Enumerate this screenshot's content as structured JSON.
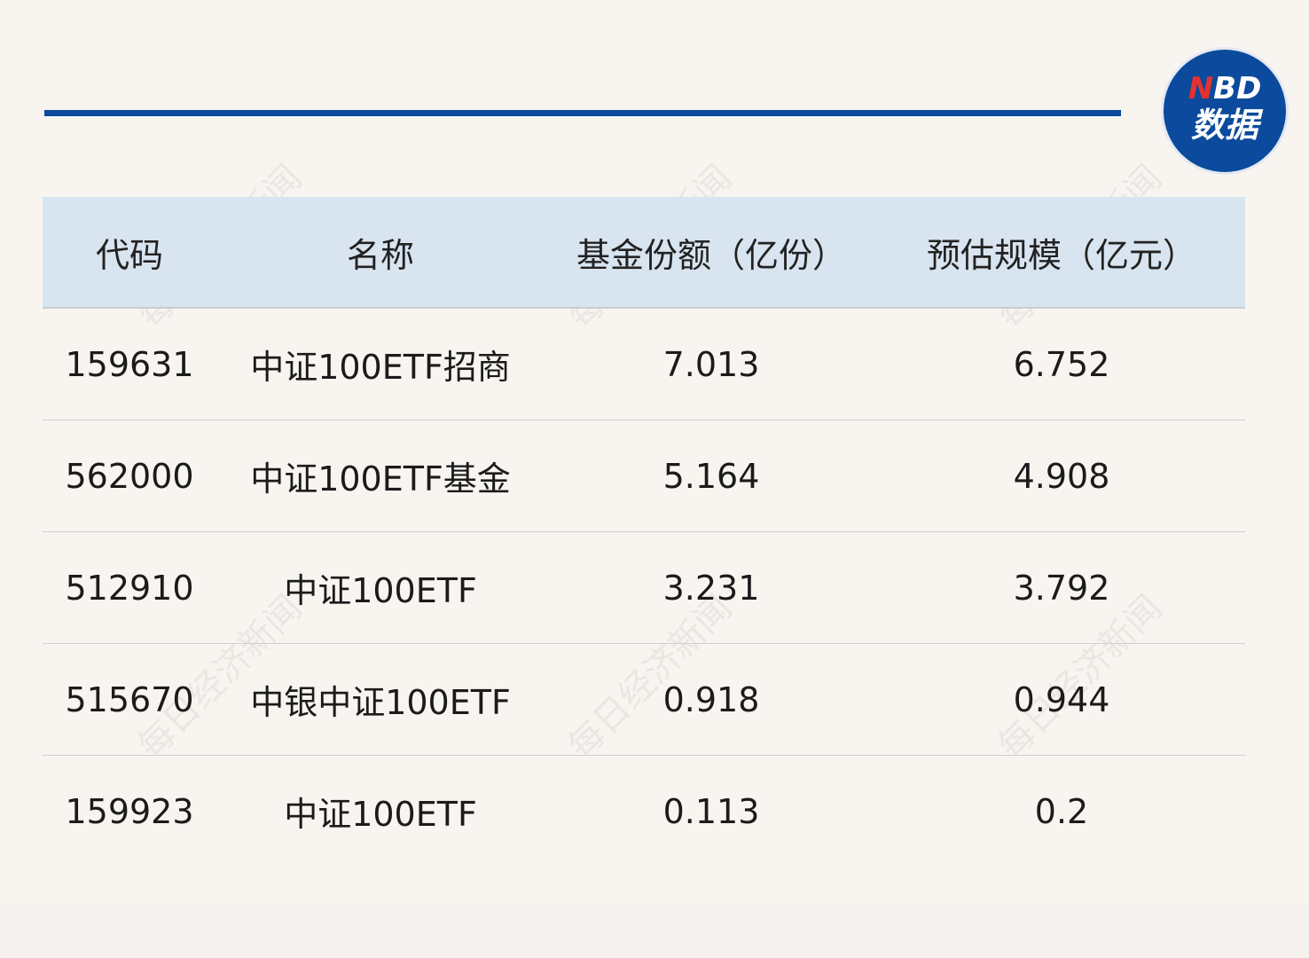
{
  "logo": {
    "top_accent": "N",
    "top_rest": "BD",
    "bottom": "数据"
  },
  "watermark": "每日经济新闻",
  "table": {
    "headers": [
      "代码",
      "名称",
      "基金份额（亿份）",
      "预估规模（亿元）"
    ],
    "rows": [
      {
        "code": "159631",
        "name": "中证100ETF招商",
        "share": "7.013",
        "scale": "6.752"
      },
      {
        "code": "562000",
        "name": "中证100ETF基金",
        "share": "5.164",
        "scale": "4.908"
      },
      {
        "code": "512910",
        "name": "中证100ETF",
        "share": "3.231",
        "scale": "3.792"
      },
      {
        "code": "515670",
        "name": "中银中证100ETF",
        "share": "0.918",
        "scale": "0.944"
      },
      {
        "code": "159923",
        "name": "中证100ETF",
        "share": "0.113",
        "scale": "0.2"
      }
    ]
  },
  "colors": {
    "brand_blue": "#0b4a9c",
    "accent_red": "#e8312e",
    "header_bg": "#d8e4ef",
    "page_bg": "#f8f5f1"
  }
}
